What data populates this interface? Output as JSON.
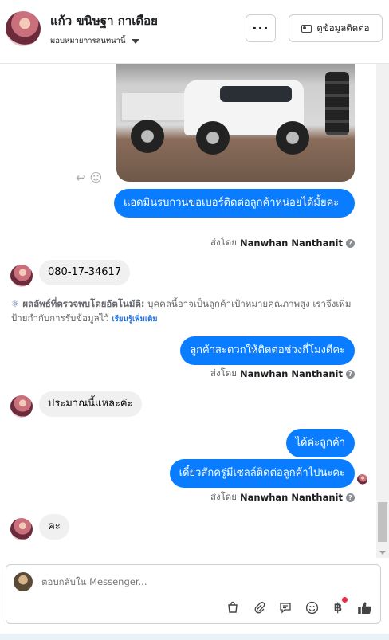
{
  "header": {
    "name": "แก้ว ขนิษฐา กาเดือย",
    "assign_label": "มอบหมายการสนทนานี้",
    "more_label": "···",
    "contact_label": "ดูข้อมูลติดต่อ"
  },
  "messages": [
    {
      "id": "m1",
      "direction": "out",
      "text": "แอดมินรบกวนขอเบอร์ติดต่อลูกค้าหน่อยได้มั้ยคะ"
    },
    {
      "id": "s1",
      "direction": "meta",
      "prefix": "ส่งโดย",
      "sender": "Nanwhan Nanthanit"
    },
    {
      "id": "m2",
      "direction": "in",
      "text": "080-17-34617"
    },
    {
      "id": "m3",
      "direction": "out",
      "text": "ลูกค้าสะดวกให้ติดต่อช่วงกี่โมงดีคะ"
    },
    {
      "id": "s2",
      "direction": "meta",
      "prefix": "ส่งโดย",
      "sender": "Nanwhan Nanthanit"
    },
    {
      "id": "m4",
      "direction": "in",
      "text": "ประมาณนี้แหละค่ะ"
    },
    {
      "id": "m5",
      "direction": "out",
      "text": "ได้ค่ะลูกค้า"
    },
    {
      "id": "m6",
      "direction": "out",
      "text": "เดี๋ยวสักครู่มีเซลล์ติดต่อลูกค้าไปนะคะ"
    },
    {
      "id": "s3",
      "direction": "meta",
      "prefix": "ส่งโดย",
      "sender": "Nanwhan Nanthanit"
    },
    {
      "id": "m7",
      "direction": "in",
      "text": "คะ"
    }
  ],
  "auto_detect": {
    "label": "ผลลัพธ์ที่ตรวจพบโดยอัตโนมัติ:",
    "text": "บุคคลนี้อาจเป็นลูกค้าเป้าหมายคุณภาพสูง เราจึงเพิ่มป้ายกำกับการรับข้อมูลไว้",
    "link": "เรียนรู้เพิ่มเติม"
  },
  "composer": {
    "placeholder": "ตอบกลับใน Messenger..."
  },
  "icons": [
    "reply-icon",
    "emoji-icon",
    "shopping-bag-icon",
    "attachment-icon",
    "saved-reply-icon",
    "sticker-icon",
    "baht-payment-icon",
    "like-icon"
  ],
  "colors": {
    "accent": "#0a7cff",
    "incoming": "#f0f0f0",
    "badge": "#f02849"
  }
}
